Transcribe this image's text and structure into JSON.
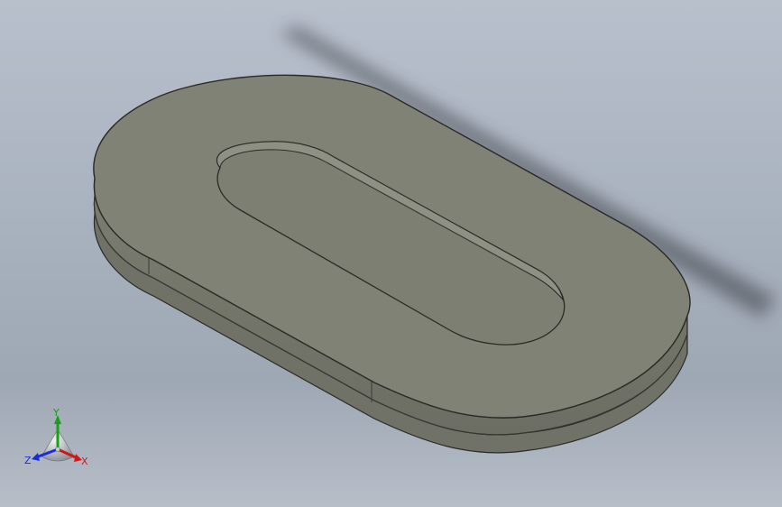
{
  "viewport": {
    "background_top": "#b8c0cc",
    "background_bottom": "#9ea7b4",
    "part_face_color": "#808276",
    "part_edge_color": "#2a2a26"
  },
  "part": {
    "shape": "obround plate with obround slot",
    "view": "isometric"
  },
  "triad": {
    "x_label": "X",
    "y_label": "Y",
    "z_label": "Z",
    "x_color": "#d01818",
    "y_color": "#18a018",
    "z_color": "#1a2ed8"
  }
}
